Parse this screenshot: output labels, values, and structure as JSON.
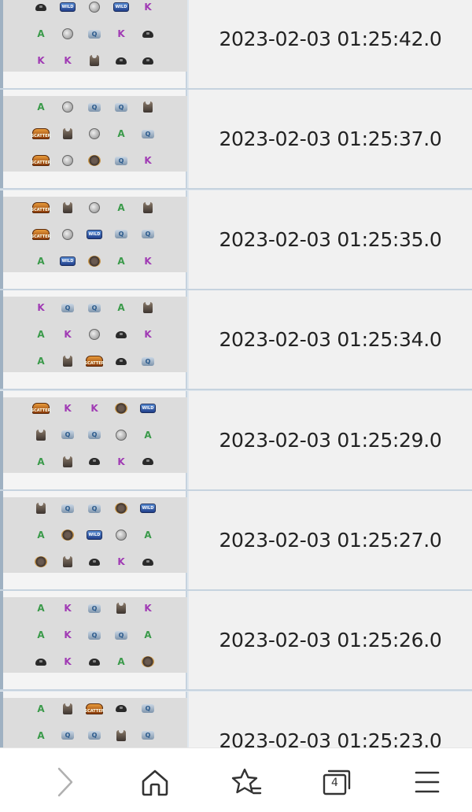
{
  "history": {
    "rows": [
      {
        "time": "2023-02-03 01:25:42.0",
        "symbols": [
          [
            "helmet",
            "wild",
            "grenade",
            "wild",
            "K"
          ],
          [
            "A",
            "grenade",
            "Q",
            "K",
            "helmet"
          ],
          [
            "K",
            "K",
            "vest",
            "helmet",
            "helmet"
          ]
        ]
      },
      {
        "time": "2023-02-03 01:25:37.0",
        "symbols": [
          [
            "A",
            "grenade",
            "Q",
            "Q",
            "vest"
          ],
          [
            "scatter",
            "vest",
            "grenade",
            "A",
            "Q"
          ],
          [
            "scatter",
            "grenade",
            "scope",
            "Q",
            "K"
          ]
        ]
      },
      {
        "time": "2023-02-03 01:25:35.0",
        "symbols": [
          [
            "scatter",
            "vest",
            "grenade",
            "A",
            "vest"
          ],
          [
            "scatter",
            "grenade",
            "wild",
            "Q",
            "Q"
          ],
          [
            "A",
            "wild",
            "scope",
            "A",
            "K"
          ]
        ]
      },
      {
        "time": "2023-02-03 01:25:34.0",
        "symbols": [
          [
            "K",
            "Q",
            "Q",
            "A",
            "vest"
          ],
          [
            "A",
            "K",
            "grenade",
            "helmet",
            "K"
          ],
          [
            "A",
            "vest",
            "scatter",
            "helmet",
            "Q"
          ]
        ]
      },
      {
        "time": "2023-02-03 01:25:29.0",
        "symbols": [
          [
            "scatter",
            "K",
            "K",
            "scope",
            "wild"
          ],
          [
            "vest",
            "Q",
            "Q",
            "grenade",
            "A"
          ],
          [
            "A",
            "vest",
            "helmet",
            "K",
            "helmet"
          ]
        ]
      },
      {
        "time": "2023-02-03 01:25:27.0",
        "symbols": [
          [
            "vest",
            "Q",
            "Q",
            "scope",
            "wild"
          ],
          [
            "A",
            "scope",
            "wild",
            "grenade",
            "A"
          ],
          [
            "scope",
            "vest",
            "helmet",
            "K",
            "helmet"
          ]
        ]
      },
      {
        "time": "2023-02-03 01:25:26.0",
        "symbols": [
          [
            "A",
            "K",
            "Q",
            "vest",
            "K"
          ],
          [
            "A",
            "K",
            "Q",
            "Q",
            "A"
          ],
          [
            "helmet",
            "K",
            "helmet",
            "A",
            "scope"
          ]
        ]
      },
      {
        "time": "2023-02-03 01:25:23.0",
        "symbols": [
          [
            "A",
            "vest",
            "scatter",
            "helmet",
            "Q"
          ],
          [
            "A",
            "Q",
            "Q",
            "vest",
            "Q"
          ],
          [
            "",
            "",
            "",
            "",
            ""
          ]
        ]
      }
    ]
  },
  "symbol_text": {
    "wild": "WILD",
    "scatter": "SCATTER",
    "Q": "Q"
  },
  "nav": {
    "forward_icon": "chevron-right-icon",
    "home_icon": "home-icon",
    "bookmarks_icon": "star-list-icon",
    "tabs_icon": "tabs-icon",
    "tabs_count": "4",
    "menu_icon": "hamburger-menu-icon"
  },
  "colors": {
    "row_divider": "#c6d3df",
    "grid_bg": "#dcdcdc",
    "time_bg": "#f1f1f1",
    "nav_icon": "#333333",
    "forward_disabled": "#b0b0b0"
  }
}
